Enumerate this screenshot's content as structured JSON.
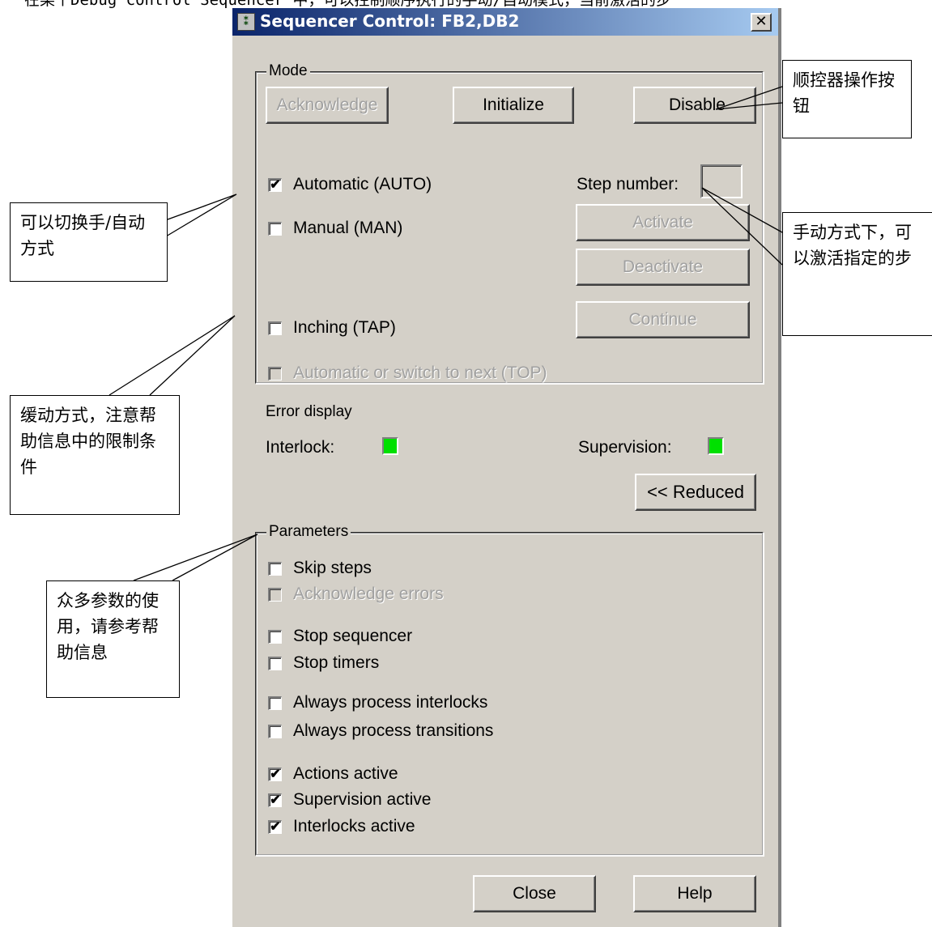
{
  "top_caption": "在某个Debug control Sequencer 中，可以控制顺序执行的手动/自动模式，当前激活的步",
  "window": {
    "title": "Sequencer Control: FB2,DB2",
    "close_glyph": "✕"
  },
  "mode": {
    "label": "Mode",
    "acknowledge": "Acknowledge",
    "initialize": "Initialize",
    "disable": "Disable",
    "automatic": {
      "label": "Automatic (AUTO)",
      "checked": true
    },
    "manual": {
      "label": "Manual (MAN)",
      "checked": false
    },
    "inching": {
      "label": "Inching (TAP)",
      "checked": false
    },
    "top": {
      "label": "Automatic or switch to next (TOP)",
      "checked": false
    },
    "step_number_label": "Step number:",
    "activate": "Activate",
    "deactivate": "Deactivate",
    "continue": "Continue"
  },
  "errors": {
    "title": "Error display",
    "interlock": "Interlock:",
    "supervision": "Supervision:",
    "led_color": "#00e000",
    "reduced_button": "<< Reduced"
  },
  "parameters": {
    "label": "Parameters",
    "skip_steps": "Skip steps",
    "acknowledge_errors": "Acknowledge errors",
    "stop_sequencer": "Stop sequencer",
    "stop_timers": "Stop timers",
    "always_interlocks": "Always process interlocks",
    "always_transitions": "Always process transitions",
    "actions_active": "Actions active",
    "supervision_active": "Supervision active",
    "interlocks_active": "Interlocks active"
  },
  "footer": {
    "close": "Close",
    "help": "Help"
  },
  "check_glyph": "✔",
  "callouts": {
    "buttons": "顺控器操作按钮",
    "switch_mode": "可以切换手/自动方式",
    "manual_step": "手动方式下，可以激活指定的步",
    "inching": "缓动方式，注意帮助信息中的限制条件",
    "params": "众多参数的使用，请参考帮助信息"
  }
}
